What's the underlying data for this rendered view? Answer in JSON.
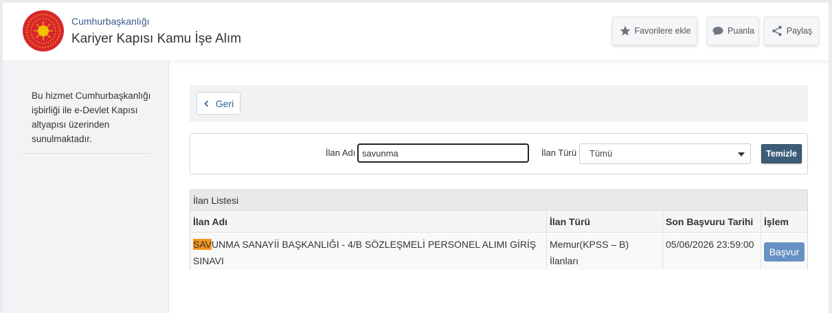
{
  "header": {
    "org_name": "Cumhurbaşkanlığı",
    "app_name": "Kariyer Kapısı Kamu İşe Alım",
    "buttons": {
      "favorite": "Favorilere ekle",
      "rate": "Puanla",
      "share": "Paylaş"
    }
  },
  "sidebar": {
    "info_text": "Bu hizmet Cumhurbaşkanlığı işbirliği ile e-Devlet Kapısı altyapısı üzerinden sunulmaktadır."
  },
  "back": {
    "label": "Geri"
  },
  "filter": {
    "name_label": "İlan Adı",
    "name_value": "savunma",
    "type_label": "İlan Türü",
    "type_selected": "Tümü",
    "clear_label": "Temizle"
  },
  "listing": {
    "title": "İlan Listesi",
    "columns": [
      "İlan Adı",
      "İlan Türü",
      "Son Başvuru Tarihi",
      "İşlem"
    ],
    "rows": [
      {
        "name_highlight": "SAV",
        "name_rest": "UNMA SANAYİİ BAŞKANLIĞI - 4/B SÖZLEŞMELİ PERSONEL ALIMI GİRİŞ SINAVI",
        "type": "Memur(KPSS – B) İlanları",
        "deadline": "05/06/2026 23:59:00",
        "action": "Başvur"
      }
    ]
  },
  "colors": {
    "accent": "#3d5c7a",
    "apply": "#6791c4",
    "highlight": "#f7931e",
    "emblem_red": "#d9262e",
    "emblem_gold": "#f2c000"
  }
}
